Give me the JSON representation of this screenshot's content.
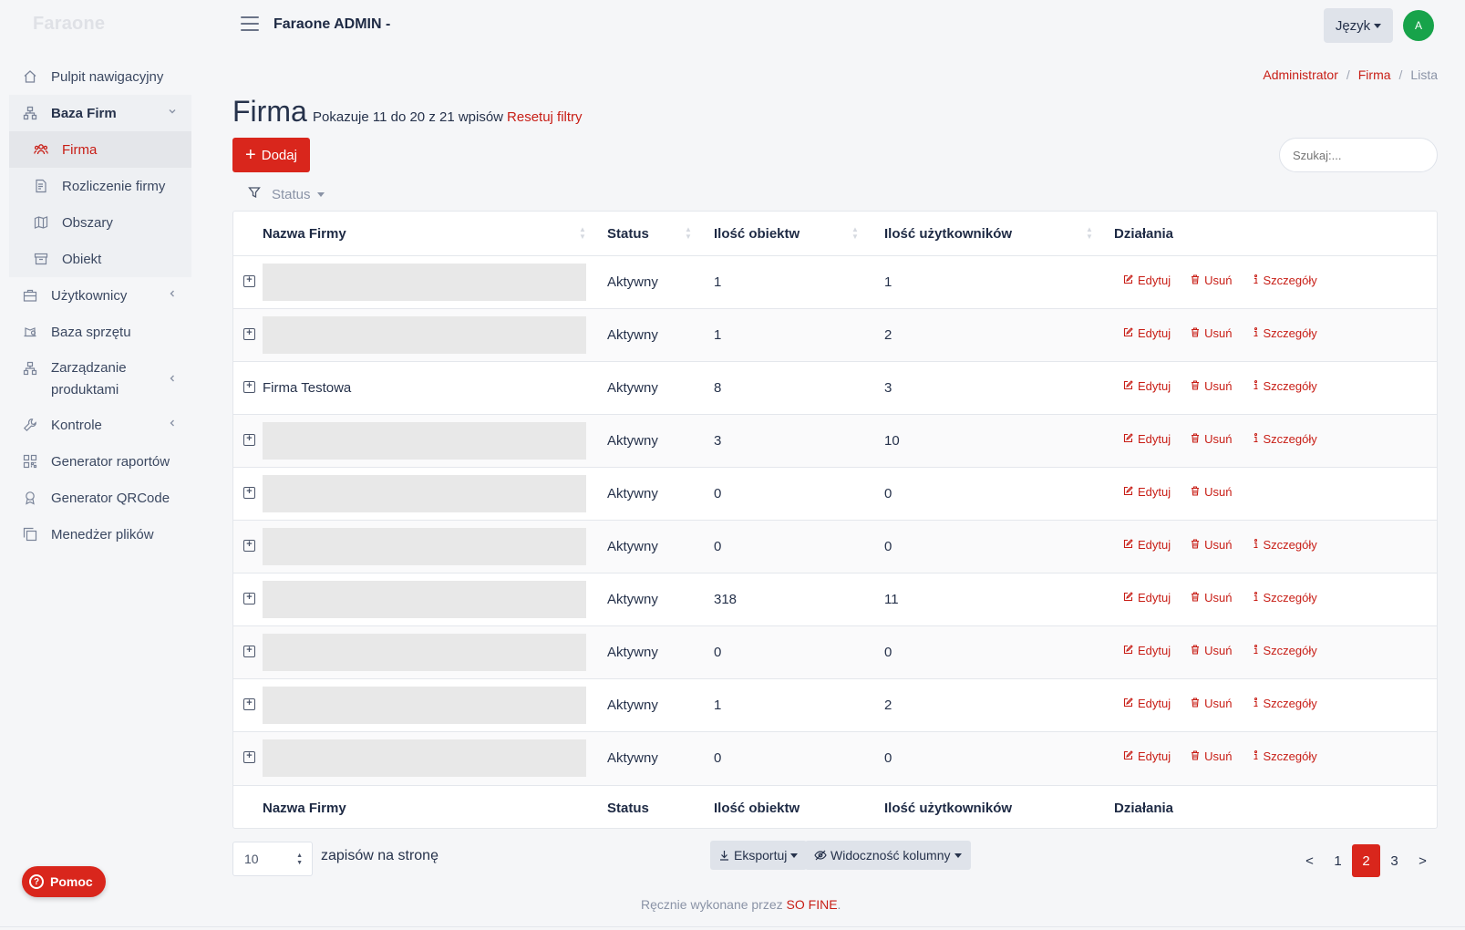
{
  "sidebar": {
    "brand": "Faraone",
    "items": [
      {
        "label": "Pulpit nawigacyjny",
        "icon": "home-icon"
      },
      {
        "label": "Baza Firm",
        "icon": "sitemap-icon"
      },
      {
        "label": "Firma",
        "icon": "users-icon"
      },
      {
        "label": "Rozliczenie firmy",
        "icon": "invoice-icon"
      },
      {
        "label": "Obszary",
        "icon": "map-icon"
      },
      {
        "label": "Obiekt",
        "icon": "archive-icon"
      },
      {
        "label": "Użytkownicy",
        "icon": "briefcase-icon"
      },
      {
        "label": "Baza sprzętu",
        "icon": "scale-icon"
      },
      {
        "label": "Zarządzanie produktami",
        "icon": "hierarchy-icon"
      },
      {
        "label": "Kontrole",
        "icon": "wrench-icon"
      },
      {
        "label": "Generator raportów",
        "icon": "qr-grid-icon"
      },
      {
        "label": "Generator QRCode",
        "icon": "badge-icon"
      },
      {
        "label": "Menedżer plików",
        "icon": "copy-icon"
      }
    ],
    "help_label": "Pomoc"
  },
  "header": {
    "title": "Faraone ADMIN -",
    "lang_label": "Język",
    "avatar_initial": "A"
  },
  "breadcrumb": [
    "Administrator",
    "Firma",
    "Lista"
  ],
  "page": {
    "title": "Firma",
    "info": "Pokazuje 11 do 20 z 21 wpisów",
    "reset_label": "Resetuj filtry",
    "add_label": "Dodaj",
    "search_placeholder": "Szukaj:...",
    "filter_label": "Status"
  },
  "table": {
    "columns": [
      "Nazwa Firmy",
      "Status",
      "Ilość obiektw",
      "Ilość użytkowników",
      "Działania"
    ],
    "action_labels": {
      "edit": "Edytuj",
      "delete": "Usuń",
      "details": "Szczegóły"
    },
    "rows": [
      {
        "name": "",
        "status": "Aktywny",
        "objects": "1",
        "users": "1",
        "details": true
      },
      {
        "name": "",
        "status": "Aktywny",
        "objects": "1",
        "users": "2",
        "details": true
      },
      {
        "name": "Firma Testowa",
        "status": "Aktywny",
        "objects": "8",
        "users": "3",
        "details": true
      },
      {
        "name": "",
        "status": "Aktywny",
        "objects": "3",
        "users": "10",
        "details": true
      },
      {
        "name": "",
        "status": "Aktywny",
        "objects": "0",
        "users": "0",
        "details": false
      },
      {
        "name": "",
        "status": "Aktywny",
        "objects": "0",
        "users": "0",
        "details": true
      },
      {
        "name": "",
        "status": "Aktywny",
        "objects": "318",
        "users": "11",
        "details": true
      },
      {
        "name": "",
        "status": "Aktywny",
        "objects": "0",
        "users": "0",
        "details": true
      },
      {
        "name": "",
        "status": "Aktywny",
        "objects": "1",
        "users": "2",
        "details": true
      },
      {
        "name": "",
        "status": "Aktywny",
        "objects": "0",
        "users": "0",
        "details": true
      }
    ]
  },
  "bottom": {
    "per_page_value": "10",
    "per_page_label": "zapisów na stronę",
    "export_label": "Eksportuj",
    "columns_label": "Widoczność kolumny",
    "pages": [
      "<",
      "1",
      "2",
      "3",
      ">"
    ],
    "active_page": "2"
  },
  "footer": {
    "text": "Ręcznie wykonane przez",
    "brand": "SO FINE",
    "suffix": "."
  },
  "colors": {
    "accent": "#d9261c",
    "avatar": "#17a34a"
  }
}
